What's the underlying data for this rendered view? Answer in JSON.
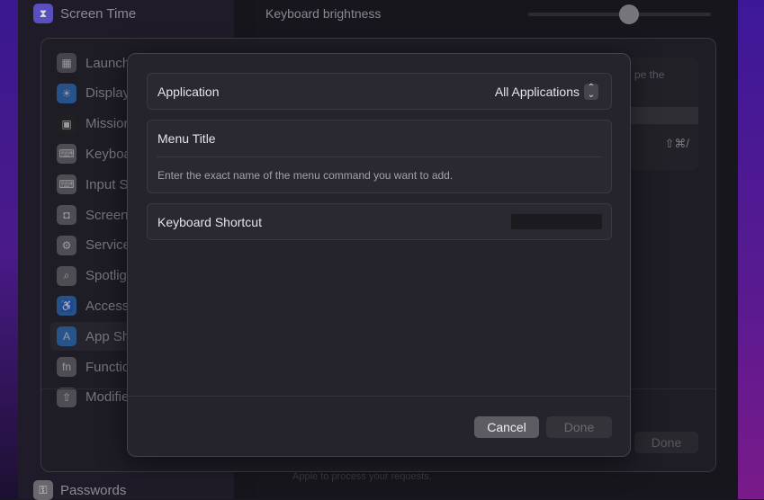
{
  "background_sidebar": {
    "top_item": {
      "label": "Screen Time",
      "icon": "hourglass-icon",
      "color": "#5a4fc0"
    },
    "bottom_item": {
      "label": "Passwords",
      "icon": "key-icon",
      "color": "#6a686e"
    }
  },
  "content": {
    "keyboard_brightness_label": "Keyboard brightness",
    "keyboard_brightness_value": 0.55,
    "footer_text": "Apple to process your requests."
  },
  "shortcuts_sheet": {
    "sidebar": [
      {
        "label": "Launchpad & Dock",
        "icon": "launchpad-icon",
        "color": "#5b5860"
      },
      {
        "label": "Display",
        "icon": "sun-icon",
        "color": "#2c6fc0"
      },
      {
        "label": "Mission Control",
        "icon": "mission-control-icon",
        "color": "#222"
      },
      {
        "label": "Keyboard",
        "icon": "keyboard-icon",
        "color": "#6a686e"
      },
      {
        "label": "Input Sources",
        "icon": "keyboard-icon",
        "color": "#6a686e"
      },
      {
        "label": "Screenshots",
        "icon": "screenshot-icon",
        "color": "#6a686e"
      },
      {
        "label": "Services",
        "icon": "gears-icon",
        "color": "#6a686e"
      },
      {
        "label": "Spotlight",
        "icon": "magnifier-icon",
        "color": "#6a686e"
      },
      {
        "label": "Accessibility",
        "icon": "accessibility-icon",
        "color": "#2a6fc0"
      },
      {
        "label": "App Shortcuts",
        "icon": "app-store-icon",
        "color": "#2a6fc0",
        "selected": true
      },
      {
        "label": "Function Keys",
        "icon": "fn-icon",
        "color": "#6a686e"
      },
      {
        "label": "Modifier Keys",
        "icon": "shift-arrow-icon",
        "color": "#6a686e"
      }
    ],
    "right_panel_text": "pe the",
    "shortcut_text": "⇧⌘/",
    "done_label": "Done"
  },
  "dialog": {
    "application_label": "Application",
    "application_value": "All Applications",
    "menu_title_label": "Menu Title",
    "menu_title_hint": "Enter the exact name of the menu command you want to add.",
    "keyboard_shortcut_label": "Keyboard Shortcut",
    "cancel_label": "Cancel",
    "done_label": "Done"
  }
}
